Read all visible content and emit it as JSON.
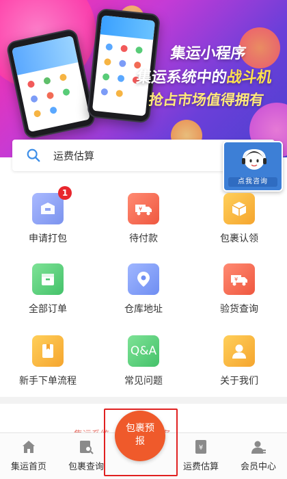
{
  "banner": {
    "line1": "集运小程序",
    "line2_a": "集运系统中的",
    "line2_b": "战斗机",
    "line3": "抢占市场值得拥有"
  },
  "search": {
    "placeholder": "运费估算"
  },
  "service": {
    "label": "点我咨询"
  },
  "menu": [
    {
      "label": "申请打包",
      "icon": "package-icon",
      "color": "#8fa6f5",
      "badge": "1"
    },
    {
      "label": "待付款",
      "icon": "truck-yen-icon",
      "color": "#f26b55"
    },
    {
      "label": "包裹认领",
      "icon": "box-icon",
      "color": "#f6b443"
    },
    {
      "label": "全部订单",
      "icon": "order-box-icon",
      "color": "#58cc78"
    },
    {
      "label": "仓库地址",
      "icon": "location-pin-icon",
      "color": "#7c9cf7"
    },
    {
      "label": "验货查询",
      "icon": "truck-yen-icon",
      "color": "#f26b55"
    },
    {
      "label": "新手下单流程",
      "icon": "bookmark-doc-icon",
      "color": "#f6b443"
    },
    {
      "label": "常见问题",
      "icon": "qa-icon",
      "color": "#5fd08a",
      "text": "Q&A"
    },
    {
      "label": "关于我们",
      "icon": "person-icon",
      "color": "#f6b443"
    }
  ],
  "marquee": "集运系统 · 正在为您服务",
  "nav": [
    {
      "label": "集运首页",
      "icon": "home-icon"
    },
    {
      "label": "包裹查询",
      "icon": "parcel-search-icon"
    },
    {
      "label": "运费估算",
      "icon": "calculator-icon"
    },
    {
      "label": "会员中心",
      "icon": "member-icon"
    }
  ],
  "fab": {
    "label": "包裹预报"
  }
}
